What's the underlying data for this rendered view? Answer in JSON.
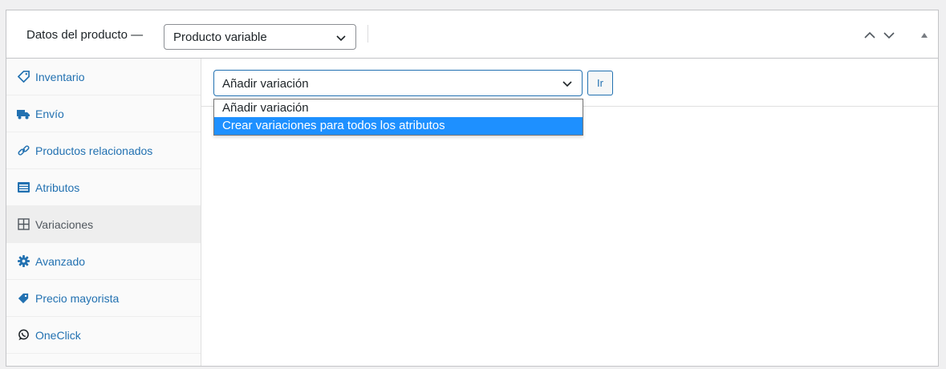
{
  "header": {
    "title": "Datos del producto —",
    "product_type": "Producto variable"
  },
  "sidebar": {
    "items": [
      {
        "label": "Inventario",
        "icon": "tag-icon"
      },
      {
        "label": "Envío",
        "icon": "truck-icon"
      },
      {
        "label": "Productos relacionados",
        "icon": "link-icon"
      },
      {
        "label": "Atributos",
        "icon": "list-icon"
      },
      {
        "label": "Variaciones",
        "icon": "grid-icon",
        "active": true
      },
      {
        "label": "Avanzado",
        "icon": "gear-icon"
      },
      {
        "label": "Precio mayorista",
        "icon": "price-tag-icon"
      },
      {
        "label": "OneClick",
        "icon": "whatsapp-icon"
      }
    ]
  },
  "variations": {
    "selected": "Añadir variación",
    "go_label": "Ir",
    "options": [
      "Añadir variación",
      "Crear variaciones para todos los atributos"
    ],
    "highlighted_index": 1
  },
  "colors": {
    "accent": "#2271b1",
    "highlight": "#1e90ff"
  }
}
